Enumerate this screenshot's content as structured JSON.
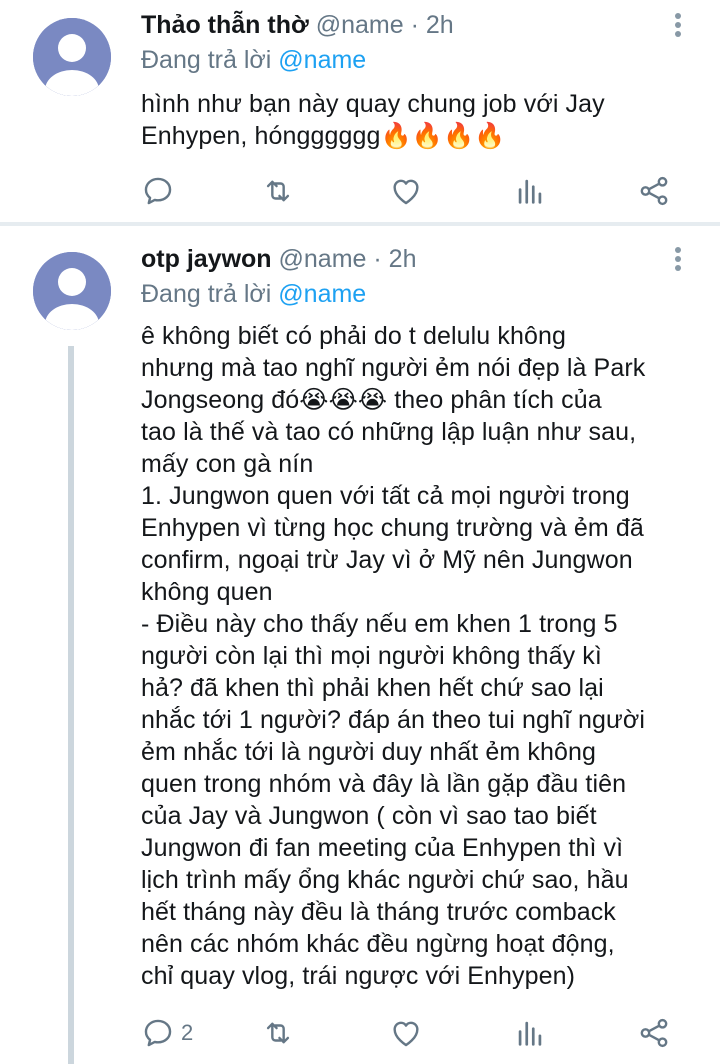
{
  "tweets": [
    {
      "display_name": "Thảo thẫn thờ",
      "handle": "@name",
      "time": "2h",
      "reply_prefix": "Đang trả lời",
      "reply_to": "@name",
      "text": "hình như bạn này quay chung job với Jay\nEnhypen, hóngggggg🔥🔥🔥🔥",
      "reply_count": "",
      "icons": [
        "reply-icon",
        "retweet-icon",
        "like-icon",
        "analytics-icon",
        "share-icon"
      ]
    },
    {
      "display_name": "otp jaywon",
      "handle": "@name",
      "time": "2h",
      "reply_prefix": "Đang trả lời",
      "reply_to": "@name",
      "text": "ê không biết có phải do t delulu không\nnhưng mà tao nghĩ người ẻm nói đẹp là Park\nJongseong đó😭😭😭 theo phân tích của\ntao là thế và tao có những lập luận như sau,\nmấy con gà nín\n1. Jungwon quen với tất cả mọi người trong\nEnhypen vì từng học chung trường và ẻm đã\nconfirm, ngoại trừ Jay vì ở Mỹ nên Jungwon\nkhông quen\n- Điều này cho thấy nếu em khen 1 trong 5\nngười còn lại thì mọi người không thấy kì\nhả? đã khen thì phải khen hết chứ sao lại\nnhắc tới 1 người? đáp án theo tui nghĩ người\nẻm nhắc tới là người duy nhất ẻm không\nquen trong nhóm và đây là lần gặp đầu tiên\ncủa Jay và Jungwon ( còn vì sao tao biết\nJungwon đi fan meeting của Enhypen thì vì\nlịch trình mấy ổng khác người chứ sao, hầu\nhết tháng này đều là tháng trước comback\nnên các nhóm khác đều ngừng hoạt động,\nchỉ quay vlog, trái ngược với Enhypen)",
      "reply_count": "2",
      "icons": [
        "reply-icon",
        "retweet-icon",
        "like-icon",
        "analytics-icon",
        "share-icon"
      ]
    }
  ],
  "separator": "·",
  "colors": {
    "avatar_bg": "#7a89c2",
    "mention": "#1da1f2",
    "meta_text": "#657786",
    "divider": "#e6ecf0",
    "thread_line": "#ccd6dd"
  }
}
